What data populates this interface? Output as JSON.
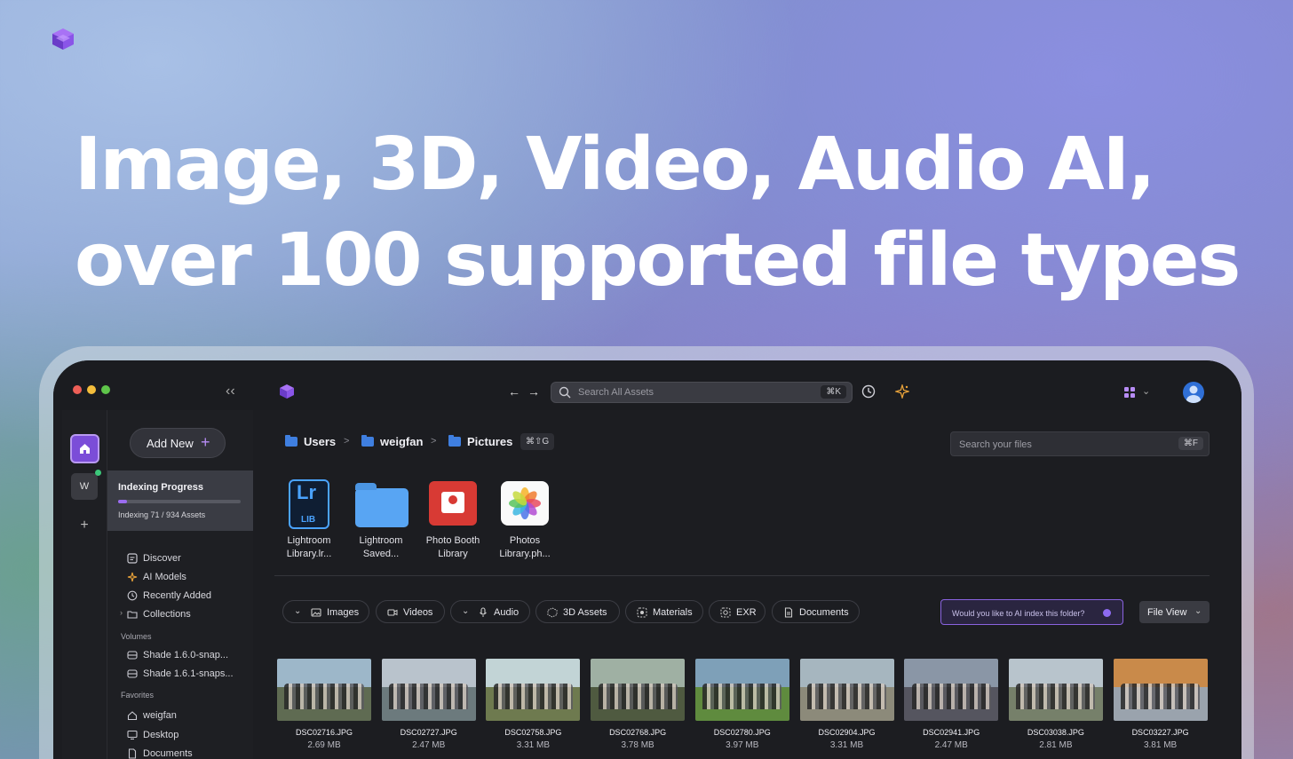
{
  "hero": {
    "line1": "Image, 3D, Video, Audio AI,",
    "line2": "over 100 supported file types"
  },
  "titlebar": {
    "collapse_icon": "double-chevron-left-icon",
    "nav_back": "←",
    "nav_forward": "→",
    "search_placeholder": "Search All Assets",
    "search_shortcut": "⌘K"
  },
  "rail": {
    "workspace_initial": "W",
    "add_label": "+"
  },
  "sidebar": {
    "add_new_label": "Add New",
    "add_new_plus": "+",
    "indexing": {
      "title": "Indexing Progress",
      "status": "Indexing 71 / 934 Assets",
      "progress_fraction": 0.076
    },
    "nav_items": [
      {
        "label": "Discover",
        "icon": "discover-icon"
      },
      {
        "label": "AI Models",
        "icon": "ai-sparkle-icon"
      },
      {
        "label": "Recently Added",
        "icon": "clock-icon"
      },
      {
        "label": "Collections",
        "icon": "folder-icon"
      }
    ],
    "volumes_heading": "Volumes",
    "volumes": [
      {
        "label": "Shade 1.6.0-snap..."
      },
      {
        "label": "Shade 1.6.1-snaps..."
      }
    ],
    "favorites_heading": "Favorites",
    "favorites": [
      {
        "label": "weigfan"
      },
      {
        "label": "Desktop"
      },
      {
        "label": "Documents"
      }
    ]
  },
  "main": {
    "breadcrumb": [
      "Users",
      "weigfan",
      "Pictures"
    ],
    "breadcrumb_separator": ">",
    "breadcrumb_shortcut": "⌘⇧G",
    "file_search_placeholder": "Search your files",
    "file_search_shortcut": "⌘F",
    "folders": [
      {
        "line1": "Lightroom",
        "line2": "Library.lr...",
        "icon": "lightroom-library-icon",
        "icon_text_big": "Lr",
        "icon_text_small": "LIB"
      },
      {
        "line1": "Lightroom",
        "line2": "Saved...",
        "icon": "folder-icon"
      },
      {
        "line1": "Photo Booth",
        "line2": "Library",
        "icon": "photo-booth-icon"
      },
      {
        "line1": "Photos",
        "line2": "Library.ph...",
        "icon": "photos-library-icon"
      }
    ],
    "filters": [
      {
        "label": "Images",
        "icon": "image-icon"
      },
      {
        "label": "Videos",
        "icon": "video-icon"
      },
      {
        "label": "Audio",
        "icon": "microphone-icon"
      },
      {
        "label": "3D Assets",
        "icon": "cube-icon"
      },
      {
        "label": "Materials",
        "icon": "materials-icon"
      },
      {
        "label": "EXR",
        "icon": "exr-icon"
      },
      {
        "label": "Documents",
        "icon": "document-icon"
      }
    ],
    "ai_prompt": "Would you like to AI index this folder?",
    "view_selector": "File View",
    "files": [
      {
        "name": "DSC02716.JPG",
        "size": "2.69 MB"
      },
      {
        "name": "DSC02727.JPG",
        "size": "2.47 MB"
      },
      {
        "name": "DSC02758.JPG",
        "size": "3.31 MB"
      },
      {
        "name": "DSC02768.JPG",
        "size": "3.78 MB"
      },
      {
        "name": "DSC02780.JPG",
        "size": "3.97 MB"
      },
      {
        "name": "DSC02904.JPG",
        "size": "3.31 MB"
      },
      {
        "name": "DSC02941.JPG",
        "size": "2.47 MB"
      },
      {
        "name": "DSC03038.JPG",
        "size": "2.81 MB"
      },
      {
        "name": "DSC03227.JPG",
        "size": "3.81 MB"
      }
    ]
  },
  "colors": {
    "accent": "#7b4dd8",
    "app_bg": "#1c1d21",
    "folder_blue": "#58a5f3"
  }
}
